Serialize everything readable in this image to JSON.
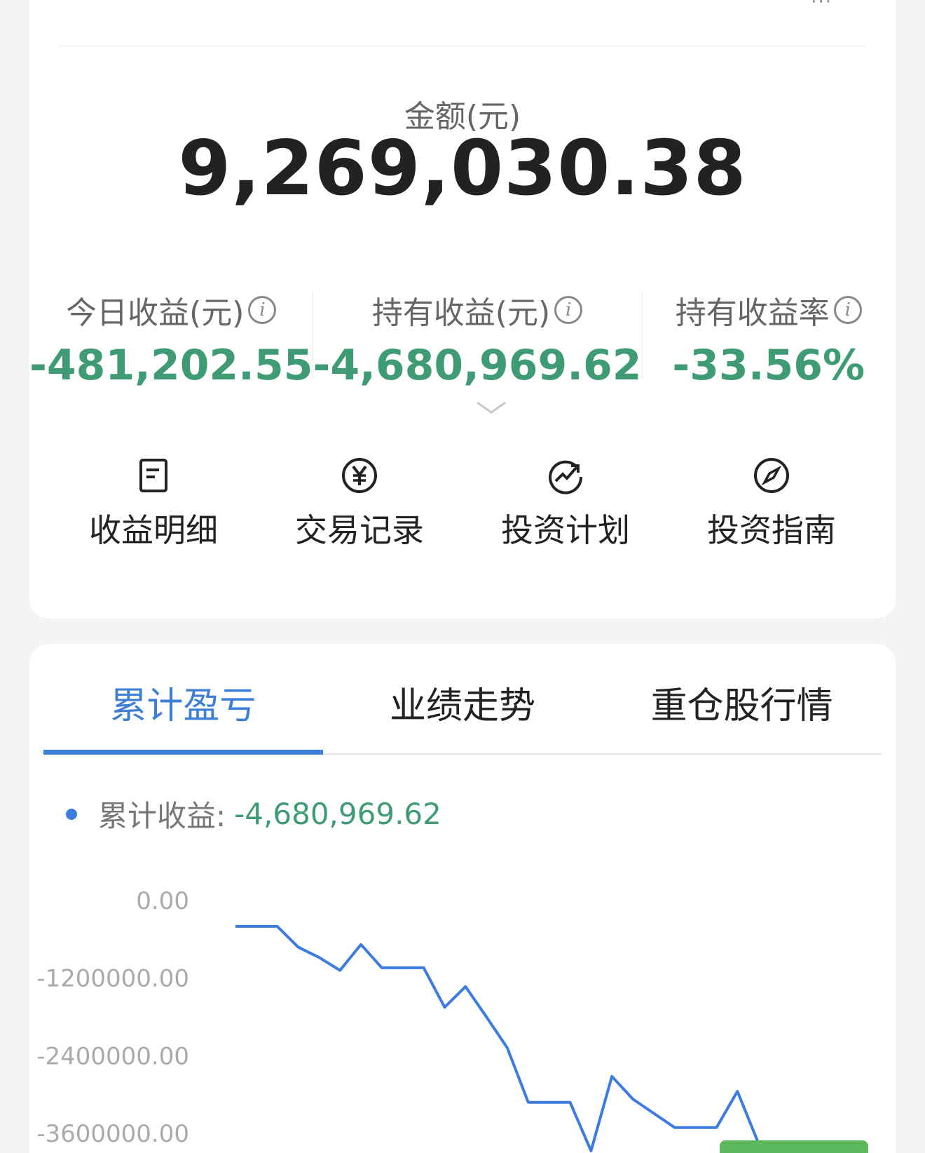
{
  "summary": {
    "amount_label": "金额(元)",
    "amount_value": "9,269,030.38",
    "stats": [
      {
        "label": "今日收益(元)",
        "value": "-481,202.55"
      },
      {
        "label": "持有收益(元)",
        "value": "-4,680,969.62"
      },
      {
        "label": "持有收益率",
        "value": "-33.56%"
      }
    ],
    "info_glyph": "i"
  },
  "actions": [
    {
      "label": "收益明细",
      "icon": "document-icon"
    },
    {
      "label": "交易记录",
      "icon": "yuan-coin-icon"
    },
    {
      "label": "投资计划",
      "icon": "trend-up-icon"
    },
    {
      "label": "投资指南",
      "icon": "compass-icon"
    }
  ],
  "tabs": [
    {
      "label": "累计盈亏",
      "active": true
    },
    {
      "label": "业绩走势",
      "active": false
    },
    {
      "label": "重仓股行情",
      "active": false
    }
  ],
  "legend": {
    "label": "累计收益:",
    "value": "-4,680,969.62"
  },
  "colors": {
    "line": "#3c7be0",
    "positive_negative_green": "#3f9b74",
    "tab_active": "#3d7fd6"
  },
  "chart_data": {
    "type": "line",
    "series": [
      {
        "values": [
          -400000,
          -400000,
          -400000,
          -720000,
          -880000,
          -1080000,
          -680000,
          -1040000,
          -1040000,
          -1040000,
          -1650000,
          -1330000,
          -1800000,
          -2280000,
          -3120000,
          -3120000,
          -3120000,
          -3870000,
          -2720000,
          -3070000,
          -3290000,
          -3510000,
          -3510000,
          -3510000,
          -2950000,
          -3750000,
          -3900000
        ]
      }
    ],
    "yticks": [
      "0.00",
      "-1200000.00",
      "-2400000.00",
      "-3600000.00"
    ],
    "ylim": [
      -3600000,
      0
    ],
    "grid": false
  }
}
